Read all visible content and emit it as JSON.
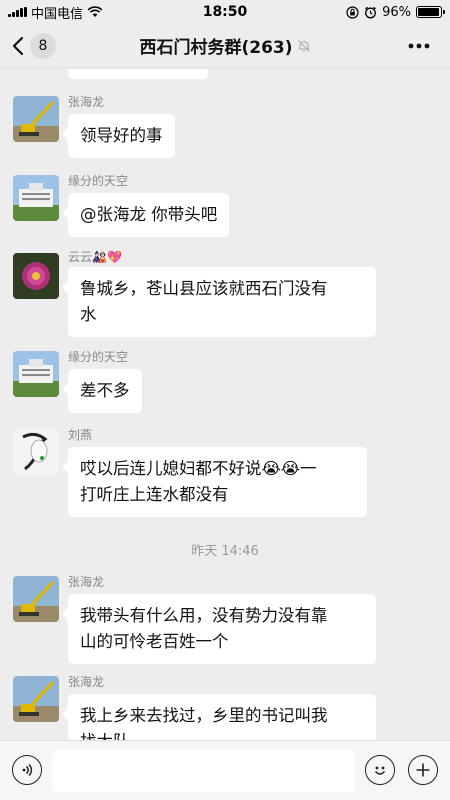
{
  "status_bar": {
    "carrier": "中国电信",
    "time": "18:50",
    "battery_percent": "96%",
    "battery_level": 0.96,
    "icons": [
      "signal-icon",
      "wifi-icon",
      "lock-rotation-icon",
      "alarm-icon",
      "battery-icon"
    ]
  },
  "nav": {
    "back_count": "8",
    "title": "西石门村务群(263)",
    "icons": [
      "back-chevron-icon",
      "mute-bell-icon",
      "more-dots-icon"
    ]
  },
  "messages": [
    {
      "sender": "张海龙",
      "avatar": "crane-photo",
      "lines": [
        "领导好的事"
      ]
    },
    {
      "sender": "缘分的天空",
      "avatar": "building-photo",
      "lines": [
        "@张海龙 你带头吧"
      ]
    },
    {
      "sender": "云云",
      "sender_emoji": "🎎💖",
      "avatar": "flower-photo",
      "lines": [
        "鲁城乡，苍山县应该就西石门没有",
        "水"
      ]
    },
    {
      "sender": "缘分的天空",
      "avatar": "building-photo",
      "lines": [
        "差不多"
      ]
    },
    {
      "sender": "刘燕",
      "avatar": "woman-sketch",
      "lines": [
        "哎以后连儿媳妇都不好说😭😭一",
        "打听庄上连水都没有"
      ]
    },
    {
      "sender": "张海龙",
      "avatar": "crane-photo",
      "lines": [
        "我带头有什么用，没有势力没有靠",
        "山的可怜老百姓一个"
      ]
    },
    {
      "sender": "张海龙",
      "avatar": "crane-photo",
      "lines": [
        "我上乡来去找过，乡里的书记叫我",
        "找大队"
      ]
    }
  ],
  "timestamp": "昨天 14:46",
  "input_bar": {
    "placeholder": "",
    "icons": [
      "voice-icon",
      "emoji-icon",
      "plus-icon"
    ]
  },
  "colors": {
    "background": "#ededed",
    "bubble": "#ffffff",
    "sender_name": "#888888",
    "timestamp": "#9a9a9a"
  }
}
